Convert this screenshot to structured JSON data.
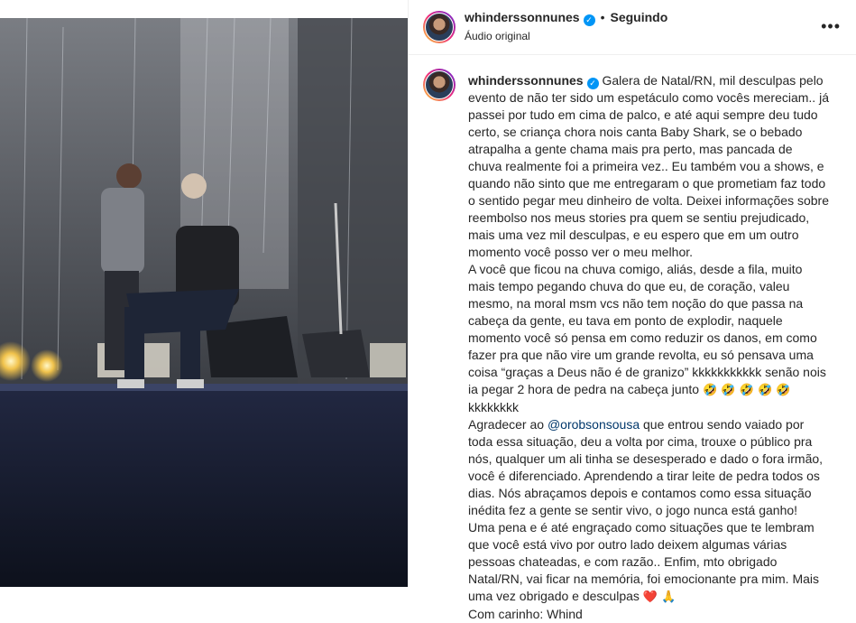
{
  "post": {
    "author": "whinderssonnunes",
    "follow_status": "Seguindo",
    "separator": "•",
    "audio_label": "Áudio original",
    "more_icon": "more-horizontal-icon"
  },
  "caption": {
    "author": "whinderssonnunes",
    "paragraph_1": "Galera de Natal/RN, mil desculpas pelo evento de não ter sido um espetáculo como vocês mereciam.. já passei por tudo em cima de palco, e até aqui sempre deu tudo certo, se criança chora nois canta Baby Shark, se o bebado atrapalha a gente chama mais pra perto, mas pancada de chuva realmente foi a primeira vez.. Eu também vou a shows, e quando não sinto que me entregaram o que prometiam faz todo o sentido pegar meu dinheiro de volta. Deixei informações sobre reembolso nos meus stories pra quem se sentiu prejudicado, mais uma vez mil desculpas, e eu espero que em um outro momento você posso ver o meu melhor.",
    "paragraph_2": "A você que ficou na chuva comigo, aliás, desde a fila, muito mais tempo pegando chuva do que eu, de coração, valeu mesmo, na moral msm vcs não tem noção do que passa na cabeça da gente, eu tava em ponto de explodir, naquele momento você só pensa em como reduzir os danos, em como fazer pra que não vire um grande revolta, eu só pensava uma coisa “graças a Deus não é de granizo” kkkkkkkkkkk senão nois ia pegar 2 hora de pedra na cabeça junto",
    "paragraph_2_emojis": "🤣 🤣 🤣 🤣 🤣",
    "paragraph_2_end": "kkkkkkkk",
    "paragraph_3_before": "Agradecer ao",
    "mention": "@orobsonsousa",
    "paragraph_3_after": "que entrou sendo vaiado por toda essa situação, deu a volta por cima, trouxe o público pra nós, qualquer um ali tinha se desesperado e dado o fora irmão, você é diferenciado. Aprendendo a tirar leite de pedra todos os dias. Nós abraçamos depois e contamos como essa situação inédita fez a gente se sentir vivo, o jogo nunca está ganho!",
    "paragraph_4": "Uma pena e é até engraçado como situações que te lembram que você está vivo por outro lado deixem algumas várias pessoas chateadas, e com razão.. Enfim, mto obrigado Natal/RN, vai ficar na memória, foi emocionante pra mim. Mais uma vez obrigado e desculpas",
    "paragraph_4_emojis": "❤️ 🙏",
    "signature": "Com carinho: Whind"
  },
  "colors": {
    "link": "#00376b",
    "verified": "#0095f6",
    "text": "#262626",
    "divider": "#efefef"
  }
}
